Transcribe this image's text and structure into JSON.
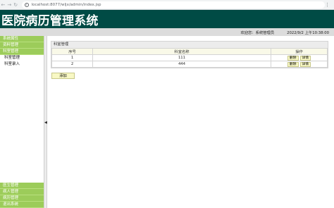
{
  "browser": {
    "url": "localhost:8077/wljx/admin/index.jsp",
    "back_icon": "←",
    "forward_icon": "→",
    "reload_icon": "↻",
    "info_icon": "i",
    "menu_icon": "⋮"
  },
  "header": {
    "title": "医院病历管理系统"
  },
  "status": {
    "welcome": "欢迎您：",
    "user": "系统管理员",
    "datetime": "2022/9/2 上午10:38:00"
  },
  "sidebar": {
    "top": [
      {
        "label": "系统属性",
        "style": "green"
      },
      {
        "label": "资料管理",
        "style": "green"
      },
      {
        "label": "科室管理",
        "style": "green"
      },
      {
        "label": "科室管理",
        "style": "sub"
      },
      {
        "label": "科室录入",
        "style": "sub"
      }
    ],
    "bottom": [
      "医生管理",
      "病人管理",
      "病历管理",
      "退出系统"
    ],
    "collapse_arrow": "◀"
  },
  "panel": {
    "title": "科室管理",
    "columns": [
      "序号",
      "科室名称",
      "操作"
    ],
    "rows": [
      {
        "index": "1",
        "name": "111"
      },
      {
        "index": "2",
        "name": "444"
      }
    ],
    "delete_label": "删除",
    "detail_label": "详情",
    "add_label": "添加"
  },
  "colors": {
    "header_bg": "#004b45",
    "sidebar_green": "#9ccc5a",
    "button_bg": "#f8f8c4"
  }
}
